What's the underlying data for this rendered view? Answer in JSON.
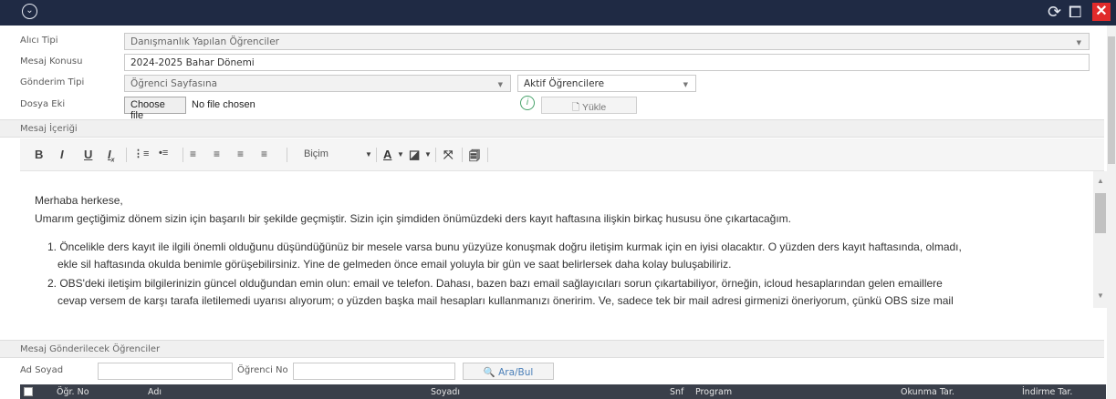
{
  "form": {
    "alici_tipi_label": "Alıcı Tipi",
    "alici_tipi_value": "Danışmanlık Yapılan Öğrenciler",
    "mesaj_konusu_label": "Mesaj Konusu",
    "mesaj_konusu_value": "2024-2025 Bahar Dönemi",
    "gonderim_tipi_label": "Gönderim Tipi",
    "gonderim_tipi_value": "Öğrenci Sayfasına",
    "hedef_value": "Aktif Öğrencilere",
    "dosya_eki_label": "Dosya Eki",
    "choose_file_label": "Choose file",
    "no_file_label": "No file chosen",
    "yukle_label": "Yükle"
  },
  "editor": {
    "section_title": "Mesaj İçeriği",
    "format_label": "Biçim",
    "greeting": "Merhaba herkese,",
    "intro": "Umarım geçtiğimiz dönem sizin için başarılı bir şekilde geçmiştir. Sizin için şimdiden önümüzdeki ders kayıt haftasına ilişkin birkaç hususu öne çıkartacağım.",
    "item1_line1": "1. Öncelikle ders kayıt ile ilgili önemli olduğunu düşündüğünüz bir mesele varsa bunu yüzyüze konuşmak doğru iletişim kurmak için en iyisi olacaktır. O yüzden ders kayıt haftasında, olmadı,",
    "item1_line2": "ekle sil haftasında okulda benimle görüşebilirsiniz. Yine de gelmeden önce email yoluyla bir gün ve saat belirlersek daha kolay buluşabiliriz.",
    "item2_line1": "2. OBS'deki iletişim bilgilerinizin güncel olduğundan emin olun: email ve telefon. Dahası, bazen bazı email sağlayıcıları sorun çıkartabiliyor, örneğin, icloud hesaplarından gelen emaillere",
    "item2_line2": "cevap versem de karşı tarafa iletilemedi uyarısı alıyorum; o yüzden başka mail hesapları kullanmanızı öneririm. Ve, sadece tek bir mail adresi girmenizi öneriyorum, çünkü OBS size mail"
  },
  "students": {
    "section_title": "Mesaj Gönderilecek Öğrenciler",
    "ad_soyad_label": "Ad Soyad",
    "ogrenci_no_label": "Öğrenci No",
    "ara_label": "Ara/Bul",
    "columns": [
      "Öğr. No",
      "Adı",
      "Soyadı",
      "Snf",
      "Program",
      "Okunma Tar.",
      "İndirme Tar."
    ]
  },
  "colors": {
    "titlebar": "#1f2a44",
    "close": "#e02b2b",
    "grid_header": "#3a3f4a"
  }
}
